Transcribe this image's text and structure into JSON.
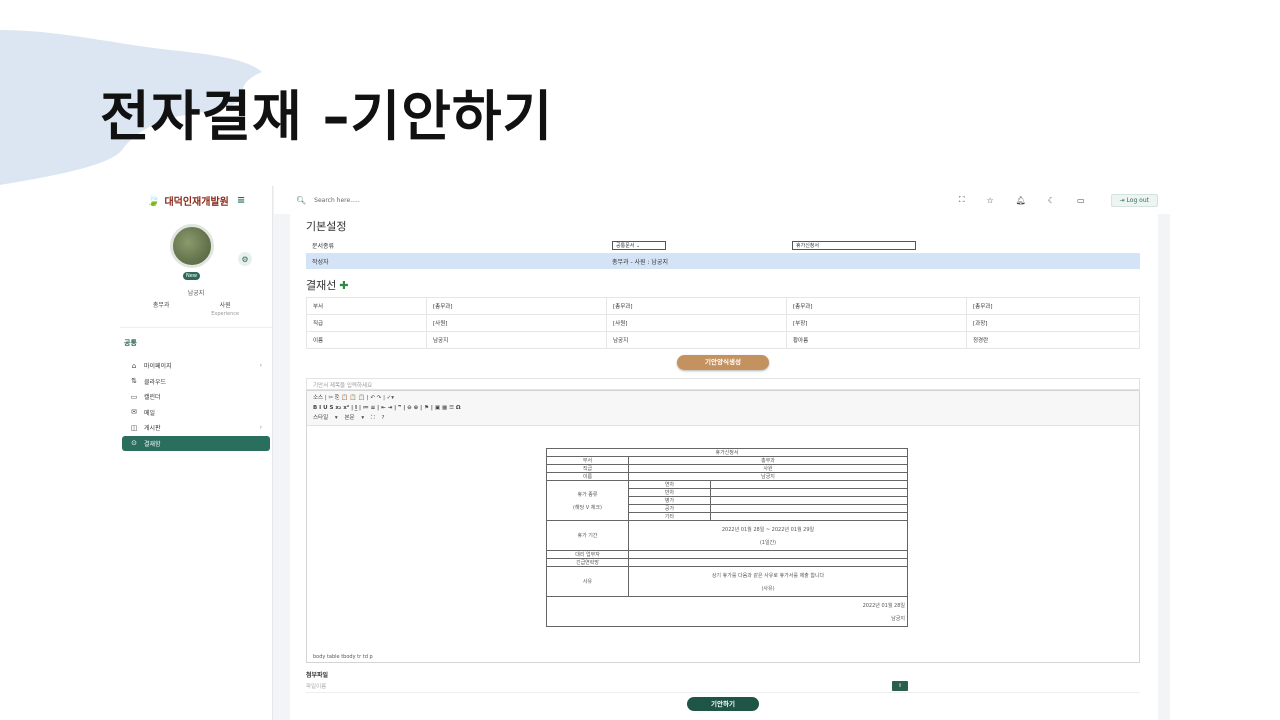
{
  "slide": {
    "title": "전자결재 –기안하기"
  },
  "sidebar": {
    "logo": "대덕인재개발원",
    "user": {
      "badge": "New",
      "name": "남궁지",
      "dept": "총무과",
      "position": "사원",
      "position_sub": "Experience"
    },
    "section": "공통",
    "items": [
      {
        "label": "마이페이지",
        "icon": "home-icon"
      },
      {
        "label": "클라우드",
        "icon": "cloud-icon"
      },
      {
        "label": "캘린더",
        "icon": "calendar-icon"
      },
      {
        "label": "메일",
        "icon": "mail-icon"
      },
      {
        "label": "게시판",
        "icon": "board-icon"
      },
      {
        "label": "결재함",
        "icon": "approval-icon"
      }
    ]
  },
  "topbar": {
    "search_placeholder": "Search here.....",
    "logout": "Log out"
  },
  "basic": {
    "title": "기본설정",
    "doc_type_label": "문서종류",
    "doc_type_value": "공통문서",
    "form_value": "휴가신청서",
    "writer_label": "작성자",
    "writer_value": "총무과 - 사원 : 남궁지"
  },
  "approval_line": {
    "title": "결재선",
    "rows": [
      [
        "부서",
        "[총무과]",
        "[총무과]",
        "[총무과]",
        "[총무과]"
      ],
      [
        "직급",
        "[사원]",
        "[사원]",
        "[부장]",
        "[과장]"
      ],
      [
        "이름",
        "남궁지",
        "남궁지",
        "황아름",
        "정경란"
      ]
    ]
  },
  "buttons": {
    "create_form": "기안양식생성",
    "submit": "기안하기"
  },
  "editor": {
    "subject_placeholder": "기안서 제목을 입력하세요",
    "toolbar_row1": "소스 | ✂ ⎘ 📋 📋 📋 | ↶ ↷ | ✓▾",
    "toolbar_row2": "B I U S x₂ x² | I̲ | ≔ ≡ | ⇤ ⇥ | ❞ | ⊖ ⊕ | ⚑ | ▣ ▦ ☰ Ω",
    "style_label": "스타일",
    "format_label": "본문",
    "path": "body  table  tbody  tr  td  p",
    "doc": {
      "title": "휴가신청서",
      "dept_label": "부서",
      "dept": "총무과",
      "rank_label": "직급",
      "rank": "사원",
      "name_label": "이름",
      "name": "남궁지",
      "type_label": "휴가 종류",
      "type_hint": "(해당 V 체크)",
      "types": [
        "연차",
        "반차",
        "병가",
        "공가",
        "기타"
      ],
      "period_label": "휴가 기간",
      "period": "2022년 01월 28일 ~ 2022년 01월 29일",
      "days": "(1일간)",
      "proxy_label": "대리 업무자",
      "contact_label": "긴급연락망",
      "reason_label": "사유",
      "reason_text": "상기 휴가를 다음과 같은 사유로 휴가서를 제출 합니다",
      "reason": "(사유)",
      "date": "2022년 01월 28일",
      "signer": "남궁지"
    }
  },
  "attach": {
    "title": "첨부파일",
    "placeholder": "파일이름",
    "upload_icon": "upload-icon"
  }
}
